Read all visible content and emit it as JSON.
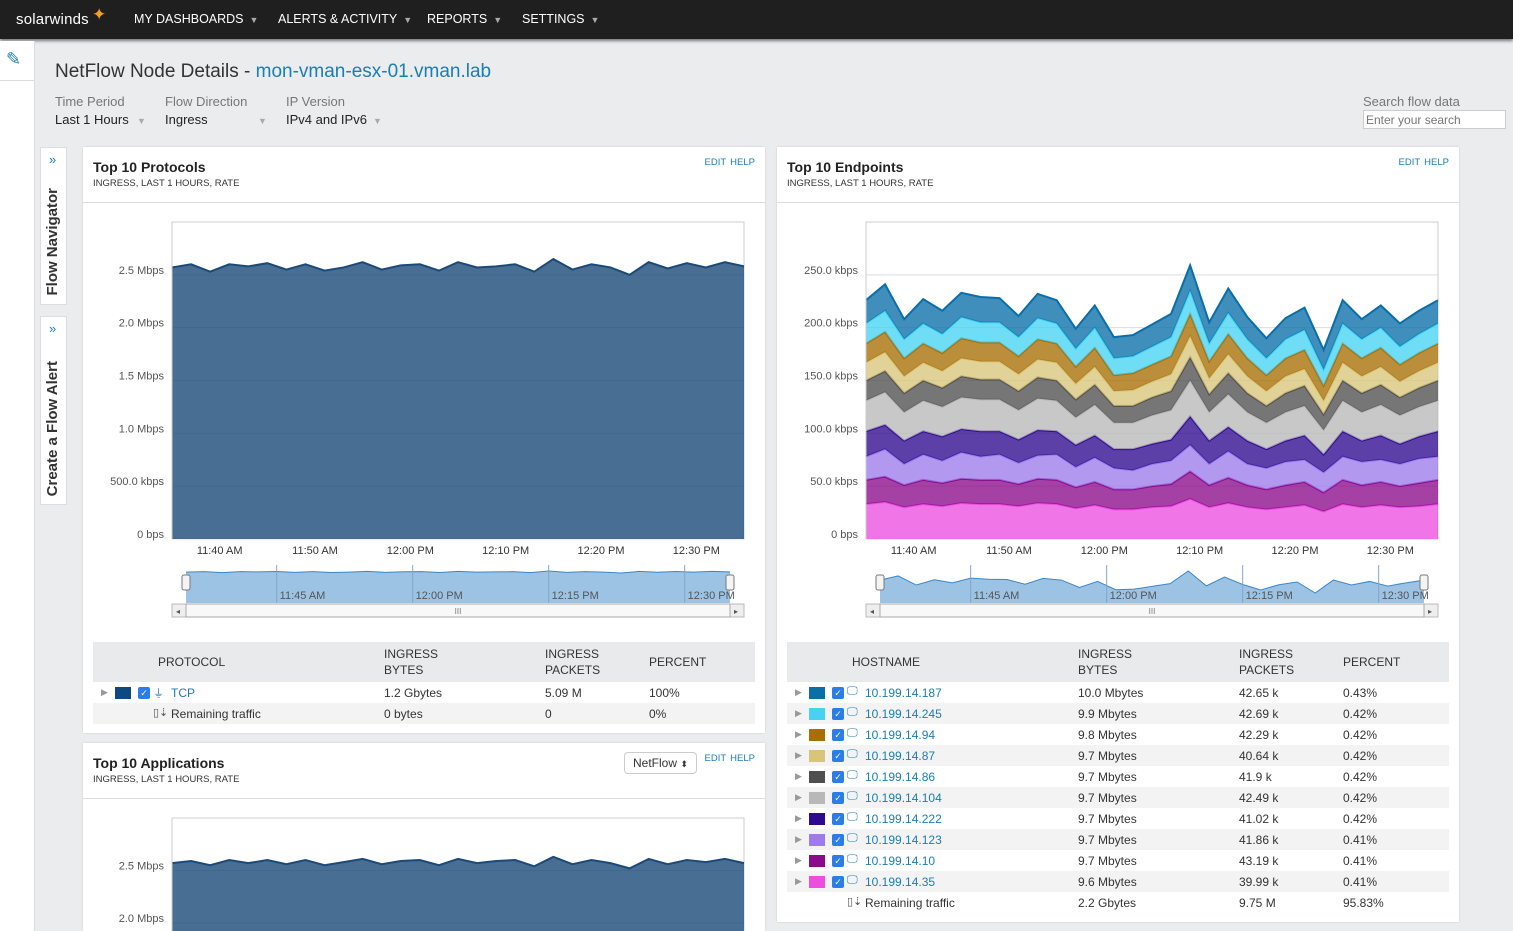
{
  "topbar": {
    "logo": "solarwinds",
    "nav": [
      "MY DASHBOARDS",
      "ALERTS & ACTIVITY",
      "REPORTS",
      "SETTINGS"
    ]
  },
  "sidetabs": {
    "navigator": "Flow Navigator",
    "alert": "Create a Flow Alert"
  },
  "page": {
    "title_prefix": "NetFlow Node Details - ",
    "node": "mon-vman-esx-01.vman.lab"
  },
  "filters": [
    {
      "label": "Time Period",
      "value": "Last 1 Hours"
    },
    {
      "label": "Flow Direction",
      "value": "Ingress"
    },
    {
      "label": "IP Version",
      "value": "IPv4 and IPv6"
    }
  ],
  "search": {
    "label": "Search flow data",
    "placeholder": "Enter your search"
  },
  "panels": {
    "protocols": {
      "title": "Top 10 Protocols",
      "subtitle": "INGRESS, LAST 1 HOURS, RATE",
      "edit": "EDIT",
      "help": "HELP",
      "columns": [
        "PROTOCOL",
        "INGRESS\nBYTES",
        "INGRESS\nPACKETS",
        "PERCENT"
      ],
      "rows": [
        {
          "name": "TCP",
          "bytes": "1.2 Gbytes",
          "packets": "5.09 M",
          "percent": "100%",
          "color": "#0e4a82",
          "checked": true
        }
      ],
      "remaining": {
        "name": "Remaining traffic",
        "bytes": "0 bytes",
        "packets": "0",
        "percent": "0%"
      }
    },
    "endpoints": {
      "title": "Top 10 Endpoints",
      "subtitle": "INGRESS, LAST 1 HOURS, RATE",
      "edit": "EDIT",
      "help": "HELP",
      "columns": [
        "HOSTNAME",
        "INGRESS\nBYTES",
        "INGRESS\nPACKETS",
        "PERCENT"
      ],
      "rows": [
        {
          "name": "10.199.14.187",
          "bytes": "10.0 Mbytes",
          "packets": "42.65 k",
          "percent": "0.43%",
          "color": "#0a6ea8",
          "checked": true
        },
        {
          "name": "10.199.14.245",
          "bytes": "9.9 Mbytes",
          "packets": "42.69 k",
          "percent": "0.42%",
          "color": "#46d3f2",
          "checked": true
        },
        {
          "name": "10.199.14.94",
          "bytes": "9.8 Mbytes",
          "packets": "42.29 k",
          "percent": "0.42%",
          "color": "#a86e05",
          "checked": true
        },
        {
          "name": "10.199.14.87",
          "bytes": "9.7 Mbytes",
          "packets": "40.64 k",
          "percent": "0.42%",
          "color": "#d9c57a",
          "checked": true
        },
        {
          "name": "10.199.14.86",
          "bytes": "9.7 Mbytes",
          "packets": "41.9 k",
          "percent": "0.42%",
          "color": "#4f4f4f",
          "checked": true
        },
        {
          "name": "10.199.14.104",
          "bytes": "9.7 Mbytes",
          "packets": "42.49 k",
          "percent": "0.42%",
          "color": "#b8b8b8",
          "checked": true
        },
        {
          "name": "10.199.14.222",
          "bytes": "9.7 Mbytes",
          "packets": "41.02 k",
          "percent": "0.42%",
          "color": "#2e0a8f",
          "checked": true
        },
        {
          "name": "10.199.14.123",
          "bytes": "9.7 Mbytes",
          "packets": "41.86 k",
          "percent": "0.41%",
          "color": "#9d7bea",
          "checked": true
        },
        {
          "name": "10.199.14.10",
          "bytes": "9.7 Mbytes",
          "packets": "43.19 k",
          "percent": "0.41%",
          "color": "#8c0a8c",
          "checked": true
        },
        {
          "name": "10.199.14.35",
          "bytes": "9.6 Mbytes",
          "packets": "39.99 k",
          "percent": "0.41%",
          "color": "#ec4fe0",
          "checked": true
        }
      ],
      "remaining": {
        "name": "Remaining traffic",
        "bytes": "2.2 Gbytes",
        "packets": "9.75 M",
        "percent": "95.83%"
      }
    },
    "applications": {
      "title": "Top 10 Applications",
      "subtitle": "INGRESS, LAST 1 HOURS, RATE",
      "edit": "EDIT",
      "help": "HELP",
      "source_select": "NetFlow"
    }
  },
  "chart_data": [
    {
      "type": "area",
      "stacked": true,
      "ylim": [
        0,
        3
      ],
      "yunit": "Mbps",
      "grid": true,
      "x": [
        "11:35",
        "11:37",
        "11:39",
        "11:41",
        "11:43",
        "11:45",
        "11:47",
        "11:49",
        "11:51",
        "11:53",
        "11:55",
        "11:57",
        "11:59",
        "12:01",
        "12:03",
        "12:05",
        "12:07",
        "12:09",
        "12:11",
        "12:13",
        "12:15",
        "12:17",
        "12:19",
        "12:21",
        "12:23",
        "12:25",
        "12:27",
        "12:29",
        "12:31",
        "12:33",
        "12:35"
      ],
      "yticks": [
        {
          "v": 0,
          "label": "0 bps"
        },
        {
          "v": 0.5,
          "label": "500.0 kbps"
        },
        {
          "v": 1,
          "label": "1.0 Mbps"
        },
        {
          "v": 1.5,
          "label": "1.5 Mbps"
        },
        {
          "v": 2,
          "label": "2.0 Mbps"
        },
        {
          "v": 2.5,
          "label": "2.5 Mbps"
        }
      ],
      "xticks": [
        "11:40 AM",
        "11:50 AM",
        "12:00 PM",
        "12:10 PM",
        "12:20 PM",
        "12:30 PM"
      ],
      "navigator_ticks": [
        "11:45 AM",
        "12:00 PM",
        "12:15 PM",
        "12:30 PM"
      ],
      "series": [
        {
          "name": "TCP",
          "color": "#1c4a78",
          "values": [
            2.57,
            2.6,
            2.53,
            2.6,
            2.58,
            2.61,
            2.55,
            2.6,
            2.54,
            2.57,
            2.62,
            2.55,
            2.59,
            2.6,
            2.54,
            2.62,
            2.57,
            2.58,
            2.6,
            2.53,
            2.65,
            2.55,
            2.6,
            2.57,
            2.5,
            2.62,
            2.56,
            2.61,
            2.57,
            2.62,
            2.58
          ]
        }
      ]
    },
    {
      "type": "area",
      "stacked": true,
      "ylim": [
        0,
        300
      ],
      "yunit": "kbps",
      "grid": true,
      "x": [
        "11:35",
        "11:37",
        "11:39",
        "11:41",
        "11:43",
        "11:45",
        "11:47",
        "11:49",
        "11:51",
        "11:53",
        "11:55",
        "11:57",
        "11:59",
        "12:01",
        "12:03",
        "12:05",
        "12:07",
        "12:09",
        "12:11",
        "12:13",
        "12:15",
        "12:17",
        "12:19",
        "12:21",
        "12:23",
        "12:25",
        "12:27",
        "12:29",
        "12:31",
        "12:33",
        "12:35"
      ],
      "yticks": [
        {
          "v": 0,
          "label": "0 bps"
        },
        {
          "v": 50,
          "label": "50.0 kbps"
        },
        {
          "v": 100,
          "label": "100.0 kbps"
        },
        {
          "v": 150,
          "label": "150.0 kbps"
        },
        {
          "v": 200,
          "label": "200.0 kbps"
        },
        {
          "v": 250,
          "label": "250.0 kbps"
        }
      ],
      "xticks": [
        "11:40 AM",
        "11:50 AM",
        "12:00 PM",
        "12:10 PM",
        "12:20 PM",
        "12:30 PM"
      ],
      "navigator_ticks": [
        "11:45 AM",
        "12:00 PM",
        "12:15 PM",
        "12:30 PM"
      ],
      "series": [
        {
          "name": "10.199.14.187",
          "color": "#0a6ea8",
          "values": [
            22,
            25,
            19,
            23,
            22,
            23,
            24,
            23,
            20,
            23,
            22,
            19,
            21,
            20,
            20,
            21,
            22,
            24,
            20,
            23,
            21,
            19,
            20,
            21,
            19,
            22,
            19,
            21,
            22,
            22,
            22
          ]
        },
        {
          "name": "10.199.14.245",
          "color": "#46d3f2",
          "values": [
            19,
            20,
            18,
            19,
            18,
            20,
            19,
            19,
            18,
            20,
            19,
            17,
            19,
            16,
            16,
            17,
            18,
            22,
            17,
            20,
            18,
            16,
            18,
            19,
            15,
            19,
            18,
            19,
            17,
            18,
            19
          ]
        },
        {
          "name": "10.199.14.94",
          "color": "#a86e05",
          "values": [
            18,
            19,
            17,
            18,
            17,
            19,
            18,
            18,
            17,
            19,
            18,
            16,
            18,
            15,
            16,
            16,
            17,
            21,
            16,
            19,
            17,
            15,
            17,
            18,
            14,
            18,
            17,
            18,
            16,
            17,
            18
          ]
        },
        {
          "name": "10.199.14.87",
          "color": "#d9c57a",
          "values": [
            17,
            18,
            16,
            17,
            16,
            17,
            17,
            17,
            16,
            17,
            17,
            15,
            17,
            14,
            15,
            15,
            16,
            20,
            15,
            18,
            16,
            14,
            16,
            16,
            13,
            17,
            16,
            17,
            15,
            16,
            17
          ]
        },
        {
          "name": "10.199.14.86",
          "color": "#4f4f4f",
          "values": [
            19,
            20,
            18,
            19,
            18,
            20,
            19,
            19,
            18,
            20,
            19,
            17,
            19,
            16,
            16,
            17,
            18,
            22,
            17,
            20,
            18,
            16,
            18,
            19,
            15,
            19,
            18,
            19,
            17,
            18,
            19
          ]
        },
        {
          "name": "10.199.14.104",
          "color": "#b8b8b8",
          "values": [
            29,
            31,
            27,
            29,
            28,
            30,
            30,
            30,
            28,
            30,
            29,
            26,
            29,
            25,
            25,
            27,
            28,
            34,
            27,
            31,
            27,
            25,
            27,
            28,
            23,
            29,
            27,
            29,
            27,
            28,
            29
          ]
        },
        {
          "name": "10.199.14.222",
          "color": "#2e0a8f",
          "values": [
            24,
            23,
            22,
            22,
            23,
            22,
            24,
            22,
            22,
            24,
            22,
            21,
            21,
            18,
            20,
            19,
            20,
            27,
            22,
            23,
            22,
            18,
            20,
            23,
            17,
            24,
            20,
            23,
            19,
            21,
            24
          ]
        },
        {
          "name": "10.199.14.123",
          "color": "#9d7bea",
          "values": [
            22,
            26,
            20,
            24,
            21,
            25,
            22,
            24,
            20,
            22,
            24,
            19,
            23,
            20,
            18,
            21,
            22,
            25,
            20,
            25,
            20,
            20,
            22,
            21,
            19,
            22,
            22,
            21,
            21,
            23,
            22
          ]
        },
        {
          "name": "10.199.14.10",
          "color": "#8c0a8c",
          "values": [
            23,
            24,
            21,
            23,
            22,
            23,
            23,
            23,
            21,
            23,
            23,
            20,
            22,
            19,
            19,
            20,
            21,
            26,
            21,
            24,
            21,
            19,
            21,
            22,
            18,
            23,
            21,
            22,
            20,
            22,
            23
          ]
        },
        {
          "name": "10.199.14.35",
          "color": "#ec4fe0",
          "values": [
            33,
            35,
            30,
            33,
            31,
            34,
            33,
            33,
            31,
            34,
            33,
            29,
            32,
            28,
            28,
            30,
            31,
            38,
            30,
            34,
            30,
            28,
            30,
            32,
            26,
            33,
            30,
            32,
            30,
            31,
            33
          ]
        }
      ]
    },
    {
      "type": "area",
      "stacked": true,
      "ylim": [
        0,
        3
      ],
      "yunit": "Mbps",
      "grid": true,
      "x": [
        "11:35",
        "11:37",
        "11:39",
        "11:41",
        "11:43",
        "11:45",
        "11:47",
        "11:49",
        "11:51",
        "11:53",
        "11:55",
        "11:57",
        "11:59",
        "12:01",
        "12:03",
        "12:05",
        "12:07",
        "12:09",
        "12:11",
        "12:13",
        "12:15",
        "12:17",
        "12:19",
        "12:21",
        "12:23",
        "12:25",
        "12:27",
        "12:29",
        "12:31",
        "12:33",
        "12:35"
      ],
      "yticks": [
        {
          "v": 2,
          "label": "2.0 Mbps"
        },
        {
          "v": 2.5,
          "label": "2.5 Mbps"
        }
      ],
      "xticks": [],
      "navigator_ticks": [],
      "series": [
        {
          "color": "#1c4a78",
          "values": [
            2.57,
            2.59,
            2.55,
            2.6,
            2.57,
            2.6,
            2.56,
            2.6,
            2.55,
            2.58,
            2.61,
            2.56,
            2.59,
            2.6,
            2.55,
            2.61,
            2.57,
            2.59,
            2.6,
            2.54,
            2.63,
            2.56,
            2.6,
            2.57,
            2.52,
            2.61,
            2.56,
            2.6,
            2.58,
            2.61,
            2.57
          ]
        }
      ]
    }
  ]
}
